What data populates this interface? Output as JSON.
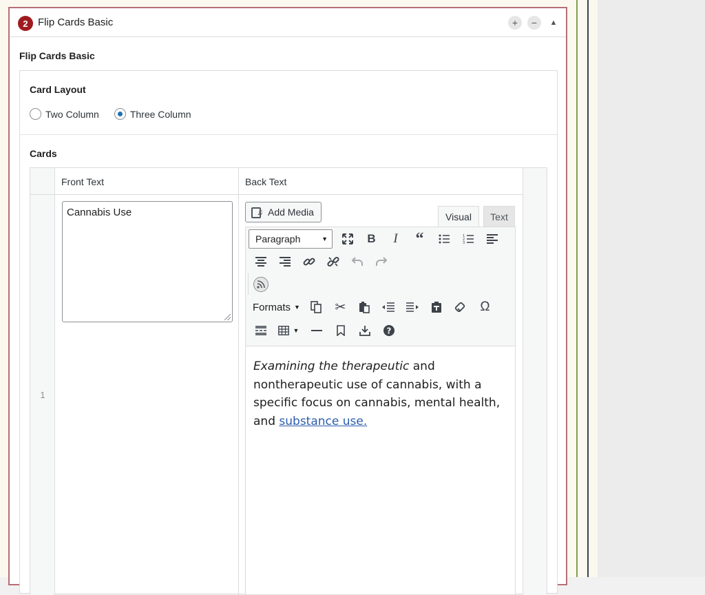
{
  "layout": {
    "order_number": "2",
    "title": "Flip Cards Basic",
    "add_button": "+",
    "remove_button": "−",
    "toggle_button": "▲",
    "sub_label": "Flip Cards Basic"
  },
  "card_layout": {
    "label": "Card Layout",
    "options": [
      "Two Column",
      "Three Column"
    ],
    "selected": "Three Column"
  },
  "cards": {
    "label": "Cards",
    "columns": [
      "Front Text",
      "Back Text"
    ],
    "rows": [
      {
        "row_number": "1",
        "front_text": "Cannabis Use",
        "back_text": {
          "italic_part": "Examining the therapeutic",
          "plain_part": " and nontherapeutic use of cannabis, with a specific focus on cannabis, mental health, and ",
          "link_text": "substance use."
        }
      }
    ]
  },
  "editor": {
    "add_media_label": "Add Media",
    "tabs": [
      "Visual",
      "Text"
    ],
    "active_tab": "Visual",
    "format_select_value": "Paragraph",
    "formats_menu_label": "Formats",
    "toolbar_icons": {
      "row1": [
        "fullscreen-icon",
        "bold-icon",
        "italic-icon",
        "blockquote-icon",
        "bullet-list-icon",
        "numbered-list-icon",
        "align-left-icon"
      ],
      "row2": [
        "align-center-icon",
        "align-right-icon",
        "link-icon",
        "unlink-icon",
        "undo-icon",
        "redo-icon"
      ],
      "row3": [
        "rss-icon"
      ],
      "row4": [
        "paste-as-text-icon",
        "cut-icon",
        "paste-icon",
        "outdent-icon",
        "indent-icon",
        "paste-from-clipboard-icon",
        "clear-formatting-icon",
        "special-character-icon"
      ],
      "row5": [
        "read-more-icon",
        "table-icon",
        "horizontal-line-icon",
        "bookmark-icon",
        "insert-icon",
        "help-icon"
      ]
    }
  },
  "colors": {
    "badge": "#9e1b1f",
    "layout_border": "#b76e76",
    "radio_checked": "#2271b1",
    "link": "#2b5cad"
  }
}
